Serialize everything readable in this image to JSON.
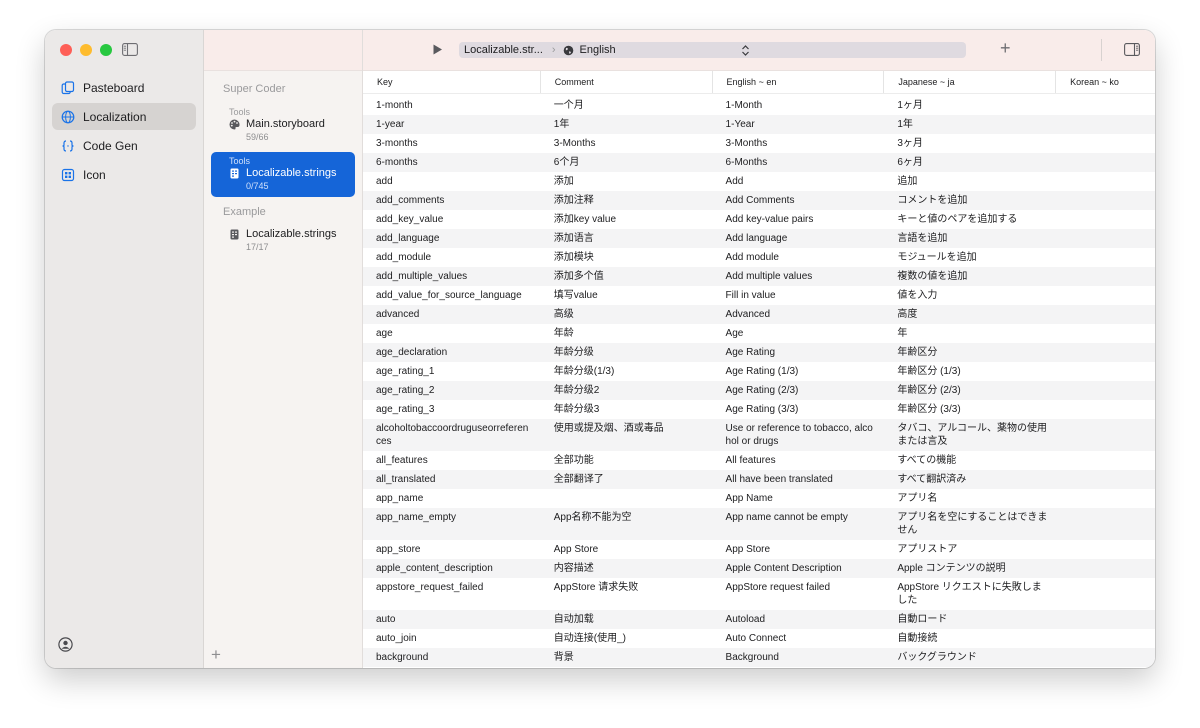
{
  "nav": {
    "items": [
      {
        "label": "Pasteboard",
        "icon": "pasteboard-icon"
      },
      {
        "label": "Localization",
        "icon": "globe-icon"
      },
      {
        "label": "Code Gen",
        "icon": "code-braces-icon"
      },
      {
        "label": "Icon",
        "icon": "grid-icon"
      }
    ]
  },
  "files": {
    "section_title": "Super Coder",
    "items": [
      {
        "sub": "Tools",
        "name": "Main.storyboard",
        "count": "59/66"
      },
      {
        "sub": "Tools",
        "name": "Localizable.strings",
        "count": "0/745"
      }
    ],
    "example_title": "Example",
    "example": {
      "name": "Localizable.strings",
      "count": "17/17"
    }
  },
  "toolbar": {
    "file": "Localizable.str...",
    "language": "English"
  },
  "table": {
    "headers": [
      "Key",
      "Comment",
      "English ~ en",
      "Japanese ~ ja",
      "Korean ~ ko"
    ],
    "rows": [
      [
        "1-month",
        "一个月",
        "1-Month",
        "1ヶ月"
      ],
      [
        "1-year",
        "1年",
        "1-Year",
        "1年"
      ],
      [
        "3-months",
        "3-Months",
        "3-Months",
        "3ヶ月"
      ],
      [
        "6-months",
        "6个月",
        "6-Months",
        "6ヶ月"
      ],
      [
        "add",
        "添加",
        "Add",
        "追加"
      ],
      [
        "add_comments",
        "添加注释",
        "Add Comments",
        "コメントを追加"
      ],
      [
        "add_key_value",
        "添加key value",
        "Add key-value pairs",
        "キーと値のペアを追加する"
      ],
      [
        "add_language",
        "添加语言",
        "Add language",
        "言語を追加"
      ],
      [
        "add_module",
        "添加模块",
        "Add module",
        "モジュールを追加"
      ],
      [
        "add_multiple_values",
        "添加多个值",
        "Add multiple values",
        "複数の値を追加"
      ],
      [
        "add_value_for_source_language",
        "填写value",
        "Fill in value",
        "値を入力"
      ],
      [
        "advanced",
        "高级",
        "Advanced",
        "高度"
      ],
      [
        "age",
        "年龄",
        "Age",
        "年"
      ],
      [
        "age_declaration",
        "年龄分级",
        "Age Rating",
        "年齢区分"
      ],
      [
        "age_rating_1",
        "年龄分级(1/3)",
        "Age Rating (1/3)",
        "年齢区分 (1/3)"
      ],
      [
        "age_rating_2",
        "年龄分级2",
        "Age Rating (2/3)",
        "年齢区分 (2/3)"
      ],
      [
        "age_rating_3",
        "年龄分级3",
        "Age Rating (3/3)",
        "年齢区分 (3/3)"
      ],
      [
        "alcoholtobaccoordruguseorreferences",
        "使用或提及烟、酒或毒品",
        "Use or reference to tobacco, alcohol or drugs",
        "タバコ、アルコール、薬物の使用または言及"
      ],
      [
        "all_features",
        "全部功能",
        "All features",
        "すべての機能"
      ],
      [
        "all_translated",
        "全部翻译了",
        "All have been translated",
        "すべて翻訳済み"
      ],
      [
        "app_name",
        "",
        "App Name",
        "アプリ名"
      ],
      [
        "app_name_empty",
        "App名称不能为空",
        "App name cannot be empty",
        "アプリ名を空にすることはできません"
      ],
      [
        "app_store",
        "App Store",
        "App Store",
        "アプリストア"
      ],
      [
        "apple_content_description",
        "内容描述",
        "Apple Content Description",
        "Apple コンテンツの説明"
      ],
      [
        "appstore_request_failed",
        "AppStore 请求失败",
        "AppStore request failed",
        "AppStore リクエストに失敗しました"
      ],
      [
        "auto",
        "自动加载",
        "Autoload",
        "自動ロード"
      ],
      [
        "auto_join",
        "自动连接(使用_)",
        "Auto Connect",
        "自動接続"
      ],
      [
        "background",
        "背景",
        "Background",
        "バックグラウンド"
      ]
    ]
  }
}
